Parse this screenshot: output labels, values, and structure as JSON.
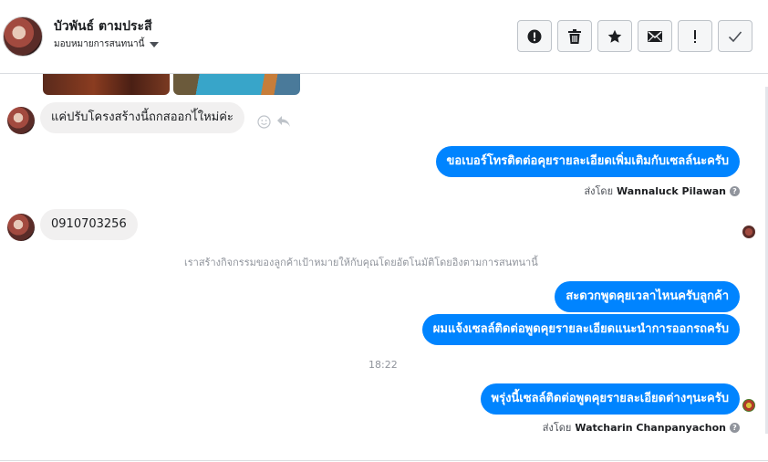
{
  "header": {
    "contact_name": "บัวพันธ์ ตามประสี",
    "assign_label": "มอบหมายการสนทนานี้",
    "toolbar": {
      "icons": [
        "alert-circle-icon",
        "trash-icon",
        "star-icon",
        "mail-icon",
        "exclamation-icon",
        "check-icon"
      ]
    }
  },
  "messages": {
    "incoming_1": "แค่ปรับโครงสร้างนี้ถกสออกไ้ใหม่ค่ะ",
    "outgoing_1": "ขอเบอร์โทรติดต่อคุยรายละเอียดเพิ่มเติมกับเซลล์นะครับ",
    "sent_by_prefix_1": "ส่งโดย",
    "sent_by_name_1": "Wannaluck Pilawan",
    "incoming_2": "0910703256",
    "system_note": "เราสร้างกิจกรรมของลูกค้าเป้าหมายให้กับคุณโดยอัตโนมัติโดยอิงตามการสนทนานี้",
    "outgoing_2": "สะดวกพูดคุยเวลาไหนครับลูกค้า",
    "outgoing_3": "ผมแจ้งเซลล์ติดต่อพูดคุยรายละเอียดแนะนำการออกรถครับ",
    "timestamp": "18:22",
    "outgoing_4": "พรุ่งนี้เซลล์ติดต่อพูดคุยรายละเอียดต่างๆนะครับ",
    "sent_by_prefix_2": "ส่งโดย",
    "sent_by_name_2": "Watcharin Chanpanyachon"
  },
  "colors": {
    "outgoing_bubble": "#0084ff",
    "incoming_bubble": "#f1f0f0",
    "muted_text": "#90949c"
  }
}
